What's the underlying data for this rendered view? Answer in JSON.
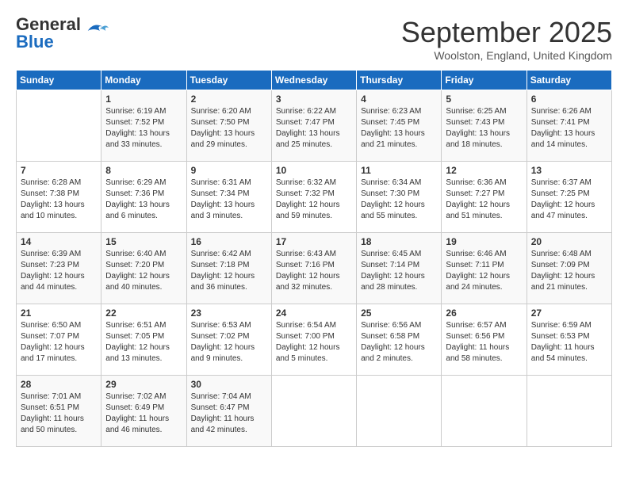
{
  "header": {
    "logo_general": "General",
    "logo_blue": "Blue",
    "month_title": "September 2025",
    "location": "Woolston, England, United Kingdom"
  },
  "days_of_week": [
    "Sunday",
    "Monday",
    "Tuesday",
    "Wednesday",
    "Thursday",
    "Friday",
    "Saturday"
  ],
  "weeks": [
    [
      {
        "day": "",
        "content": ""
      },
      {
        "day": "1",
        "content": "Sunrise: 6:19 AM\nSunset: 7:52 PM\nDaylight: 13 hours\nand 33 minutes."
      },
      {
        "day": "2",
        "content": "Sunrise: 6:20 AM\nSunset: 7:50 PM\nDaylight: 13 hours\nand 29 minutes."
      },
      {
        "day": "3",
        "content": "Sunrise: 6:22 AM\nSunset: 7:47 PM\nDaylight: 13 hours\nand 25 minutes."
      },
      {
        "day": "4",
        "content": "Sunrise: 6:23 AM\nSunset: 7:45 PM\nDaylight: 13 hours\nand 21 minutes."
      },
      {
        "day": "5",
        "content": "Sunrise: 6:25 AM\nSunset: 7:43 PM\nDaylight: 13 hours\nand 18 minutes."
      },
      {
        "day": "6",
        "content": "Sunrise: 6:26 AM\nSunset: 7:41 PM\nDaylight: 13 hours\nand 14 minutes."
      }
    ],
    [
      {
        "day": "7",
        "content": "Sunrise: 6:28 AM\nSunset: 7:38 PM\nDaylight: 13 hours\nand 10 minutes."
      },
      {
        "day": "8",
        "content": "Sunrise: 6:29 AM\nSunset: 7:36 PM\nDaylight: 13 hours\nand 6 minutes."
      },
      {
        "day": "9",
        "content": "Sunrise: 6:31 AM\nSunset: 7:34 PM\nDaylight: 13 hours\nand 3 minutes."
      },
      {
        "day": "10",
        "content": "Sunrise: 6:32 AM\nSunset: 7:32 PM\nDaylight: 12 hours\nand 59 minutes."
      },
      {
        "day": "11",
        "content": "Sunrise: 6:34 AM\nSunset: 7:30 PM\nDaylight: 12 hours\nand 55 minutes."
      },
      {
        "day": "12",
        "content": "Sunrise: 6:36 AM\nSunset: 7:27 PM\nDaylight: 12 hours\nand 51 minutes."
      },
      {
        "day": "13",
        "content": "Sunrise: 6:37 AM\nSunset: 7:25 PM\nDaylight: 12 hours\nand 47 minutes."
      }
    ],
    [
      {
        "day": "14",
        "content": "Sunrise: 6:39 AM\nSunset: 7:23 PM\nDaylight: 12 hours\nand 44 minutes."
      },
      {
        "day": "15",
        "content": "Sunrise: 6:40 AM\nSunset: 7:20 PM\nDaylight: 12 hours\nand 40 minutes."
      },
      {
        "day": "16",
        "content": "Sunrise: 6:42 AM\nSunset: 7:18 PM\nDaylight: 12 hours\nand 36 minutes."
      },
      {
        "day": "17",
        "content": "Sunrise: 6:43 AM\nSunset: 7:16 PM\nDaylight: 12 hours\nand 32 minutes."
      },
      {
        "day": "18",
        "content": "Sunrise: 6:45 AM\nSunset: 7:14 PM\nDaylight: 12 hours\nand 28 minutes."
      },
      {
        "day": "19",
        "content": "Sunrise: 6:46 AM\nSunset: 7:11 PM\nDaylight: 12 hours\nand 24 minutes."
      },
      {
        "day": "20",
        "content": "Sunrise: 6:48 AM\nSunset: 7:09 PM\nDaylight: 12 hours\nand 21 minutes."
      }
    ],
    [
      {
        "day": "21",
        "content": "Sunrise: 6:50 AM\nSunset: 7:07 PM\nDaylight: 12 hours\nand 17 minutes."
      },
      {
        "day": "22",
        "content": "Sunrise: 6:51 AM\nSunset: 7:05 PM\nDaylight: 12 hours\nand 13 minutes."
      },
      {
        "day": "23",
        "content": "Sunrise: 6:53 AM\nSunset: 7:02 PM\nDaylight: 12 hours\nand 9 minutes."
      },
      {
        "day": "24",
        "content": "Sunrise: 6:54 AM\nSunset: 7:00 PM\nDaylight: 12 hours\nand 5 minutes."
      },
      {
        "day": "25",
        "content": "Sunrise: 6:56 AM\nSunset: 6:58 PM\nDaylight: 12 hours\nand 2 minutes."
      },
      {
        "day": "26",
        "content": "Sunrise: 6:57 AM\nSunset: 6:56 PM\nDaylight: 11 hours\nand 58 minutes."
      },
      {
        "day": "27",
        "content": "Sunrise: 6:59 AM\nSunset: 6:53 PM\nDaylight: 11 hours\nand 54 minutes."
      }
    ],
    [
      {
        "day": "28",
        "content": "Sunrise: 7:01 AM\nSunset: 6:51 PM\nDaylight: 11 hours\nand 50 minutes."
      },
      {
        "day": "29",
        "content": "Sunrise: 7:02 AM\nSunset: 6:49 PM\nDaylight: 11 hours\nand 46 minutes."
      },
      {
        "day": "30",
        "content": "Sunrise: 7:04 AM\nSunset: 6:47 PM\nDaylight: 11 hours\nand 42 minutes."
      },
      {
        "day": "",
        "content": ""
      },
      {
        "day": "",
        "content": ""
      },
      {
        "day": "",
        "content": ""
      },
      {
        "day": "",
        "content": ""
      }
    ]
  ]
}
